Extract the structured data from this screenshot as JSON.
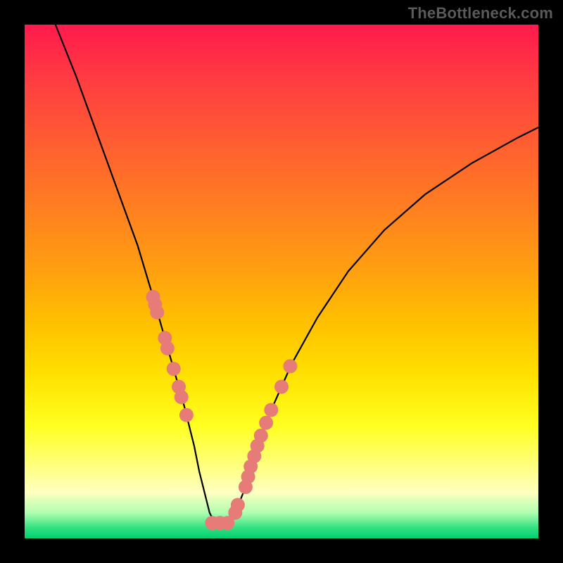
{
  "watermark": "TheBottleneck.com",
  "chart_data": {
    "type": "line",
    "title": "",
    "xlabel": "",
    "ylabel": "",
    "xlim": [
      0,
      100
    ],
    "ylim": [
      0,
      100
    ],
    "curve": {
      "x": [
        6,
        10,
        14,
        18,
        22,
        25,
        27,
        29,
        31,
        33,
        34,
        35,
        36,
        37,
        38,
        40,
        41,
        43,
        45,
        48,
        52,
        57,
        63,
        70,
        78,
        87,
        96,
        100
      ],
      "y": [
        100,
        90,
        79,
        68,
        57,
        47,
        40,
        33,
        26,
        18,
        13,
        9,
        5,
        3,
        3,
        3,
        5,
        10,
        17,
        25,
        34,
        43,
        52,
        60,
        67,
        73,
        78,
        80
      ]
    },
    "dots_left": {
      "x": [
        25.0,
        25.4,
        25.8,
        27.3,
        27.8,
        29.0,
        30.0,
        30.5,
        31.5
      ],
      "y": [
        47.0,
        45.5,
        44.0,
        39.0,
        37.0,
        33.0,
        29.5,
        27.5,
        24.0
      ]
    },
    "dots_right": {
      "x": [
        43.0,
        43.5,
        44.0,
        44.7,
        45.3,
        46.0,
        47.0,
        48.0,
        50.0,
        51.7
      ],
      "y": [
        10.0,
        12.0,
        14.0,
        16.0,
        18.0,
        20.0,
        22.5,
        25.0,
        29.5,
        33.5
      ]
    },
    "dots_bottom": {
      "x": [
        36.5,
        38.0,
        39.5,
        41.0,
        41.5
      ],
      "y": [
        3.0,
        3.0,
        3.0,
        5.0,
        6.5
      ]
    },
    "dot_style": {
      "radius": 10,
      "fill": "#e77b78"
    },
    "line_style": {
      "stroke": "#000000",
      "width": 2.2
    }
  }
}
